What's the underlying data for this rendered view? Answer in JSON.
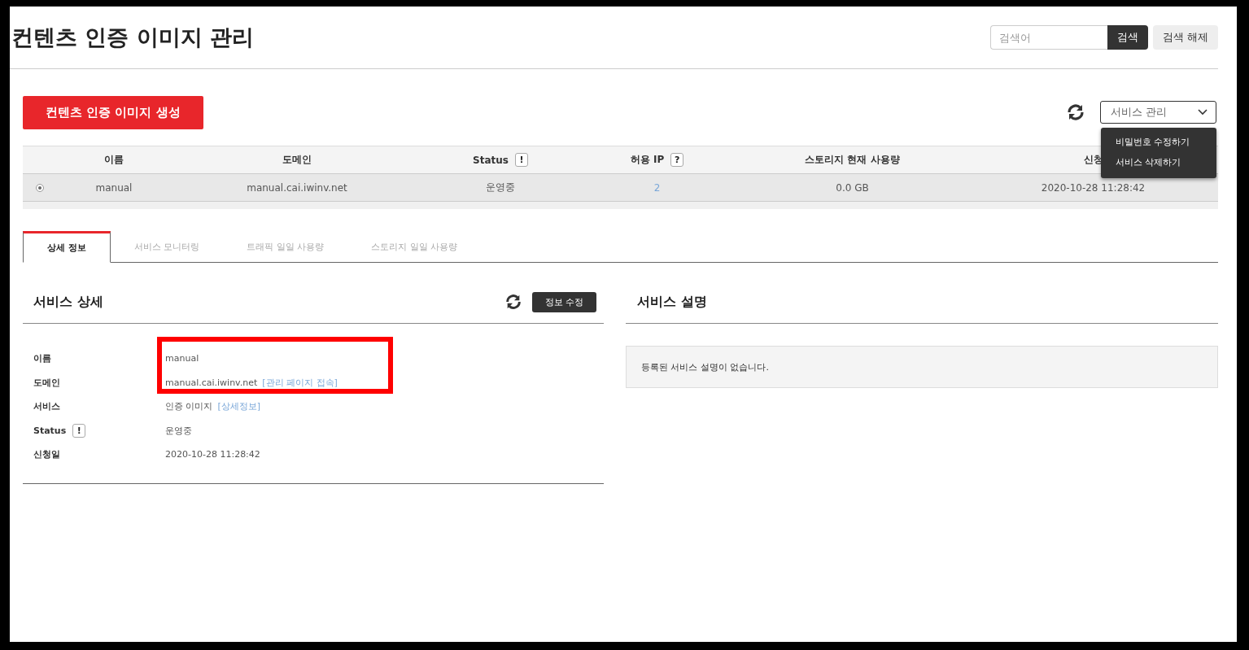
{
  "page": {
    "title": "컨텐츠 인증 이미지 관리"
  },
  "search": {
    "placeholder": "검색어",
    "button": "검색",
    "clear_button": "검색 해제"
  },
  "create_button": "컨텐츠 인증 이미지 생성",
  "service_menu": {
    "label": "서비스 관리",
    "expanded": true,
    "items": [
      "비밀번호 수정하기",
      "서비스 삭제하기"
    ]
  },
  "table": {
    "columns": [
      {
        "label": "이름"
      },
      {
        "label": "도메인"
      },
      {
        "label": "Status",
        "badge": "!"
      },
      {
        "label": "허용 IP",
        "badge": "?"
      },
      {
        "label": "스토리지 현재 사용량"
      },
      {
        "label": "신청"
      }
    ],
    "rows": [
      {
        "selected": true,
        "cells": [
          "manual",
          "manual.cai.iwinv.net",
          "운영중",
          "2",
          "0.0 GB",
          "2020-10-28 11:28:42"
        ]
      }
    ]
  },
  "tabs": [
    {
      "label": "상세 정보",
      "selected": true
    },
    {
      "label": "서비스 모니터링",
      "selected": false
    },
    {
      "label": "트래픽 일일 사용량",
      "selected": false
    },
    {
      "label": "스토리지 일일 사용량",
      "selected": false
    }
  ],
  "details": {
    "title": "서비스 상세",
    "edit_button": "정보 수정",
    "rows": [
      {
        "label": "이름",
        "value": "manual"
      },
      {
        "label": "도메인",
        "value": "manual.cai.iwinv.net",
        "link": "[관리 페이지 접속]"
      },
      {
        "label": "서비스",
        "value": "인증 이미지",
        "link": "[상세정보]"
      },
      {
        "label": "Status",
        "badge": "!",
        "value": "운영중"
      },
      {
        "label": "신청일",
        "value": "2020-10-28 11:28:42"
      }
    ]
  },
  "description": {
    "title": "서비스 설명",
    "text": "등록된 서비스 설명이 없습니다."
  },
  "highlight": {
    "kind": "rectangle"
  }
}
